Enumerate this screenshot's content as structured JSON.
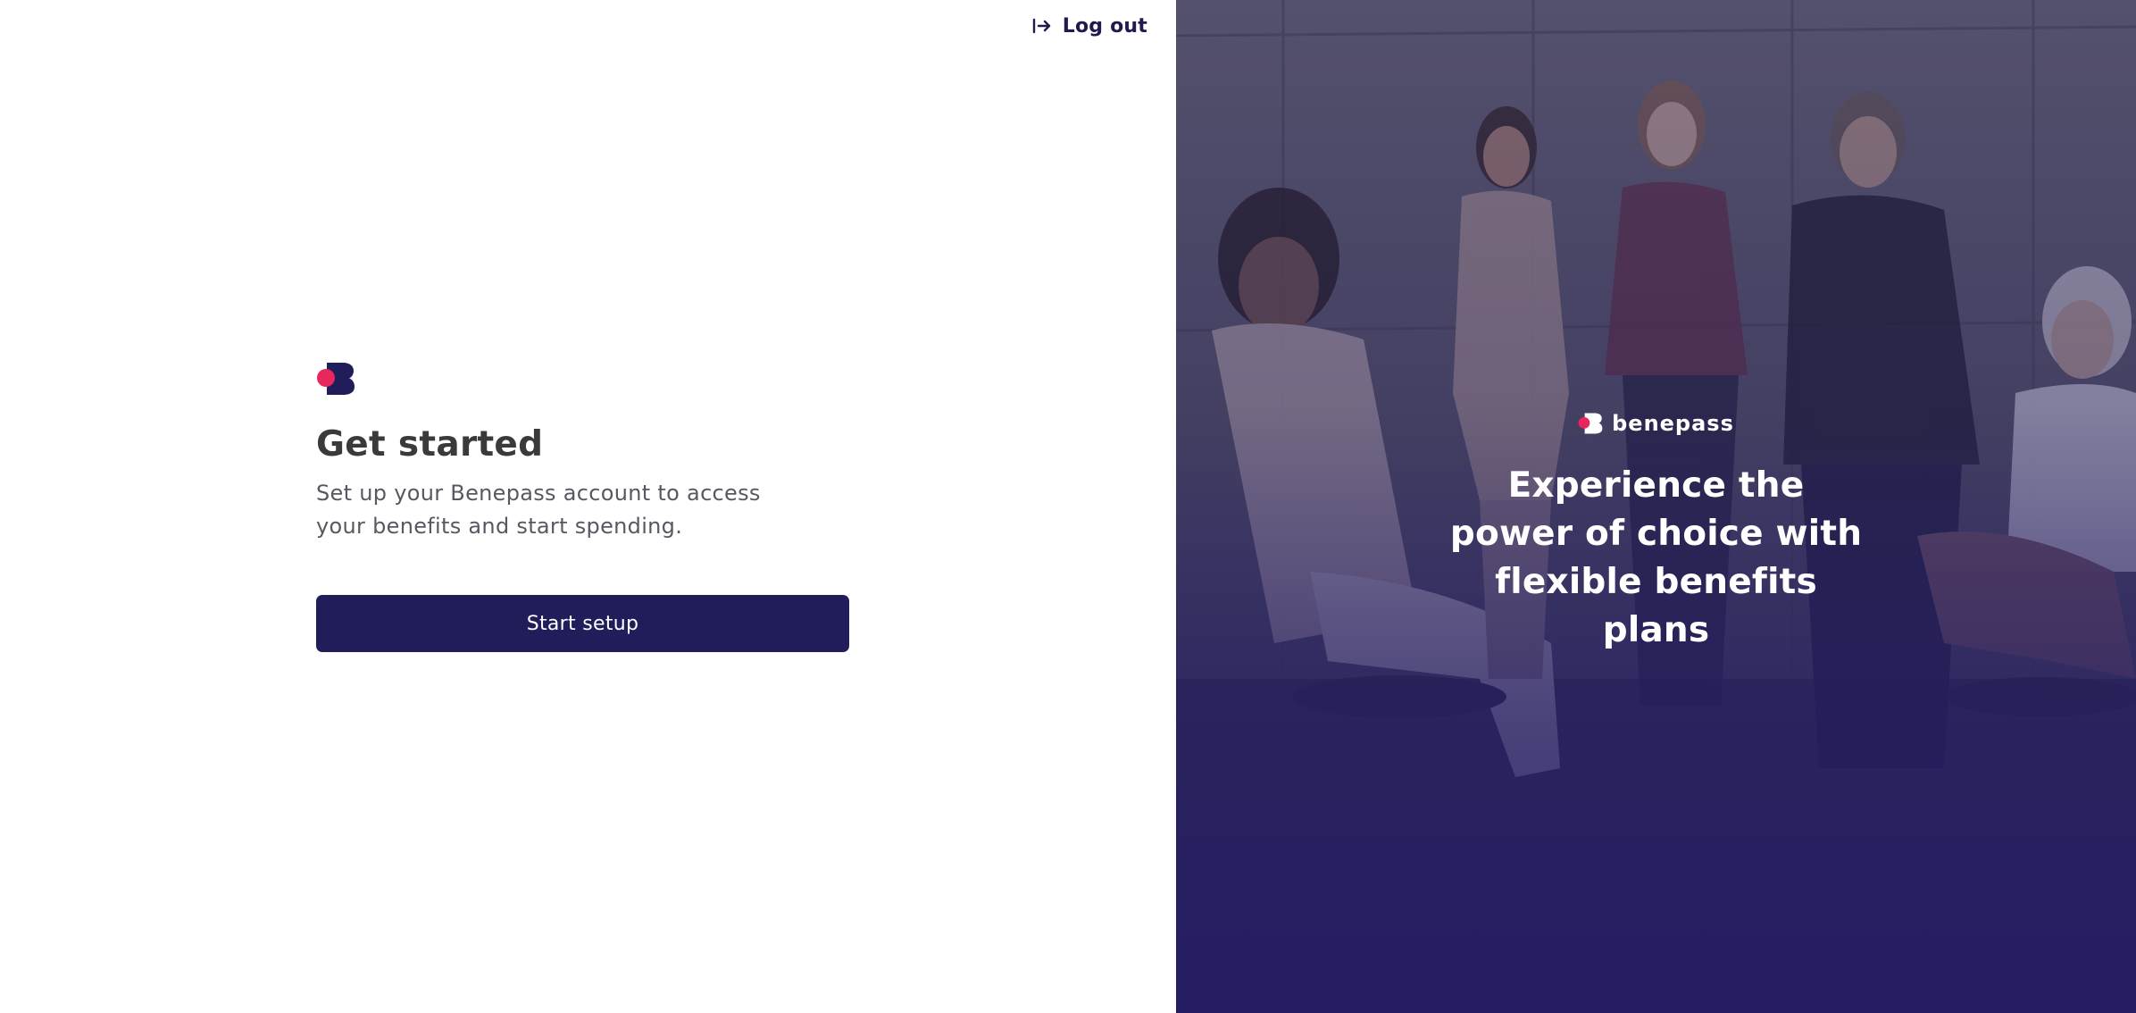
{
  "header": {
    "logout_label": "Log out",
    "logout_icon": "log-out-icon"
  },
  "main": {
    "logo_icon": "benepass-mark-icon",
    "title": "Get started",
    "subtitle": "Set up your Benepass account to access your benefits and start spending.",
    "start_button_label": "Start setup"
  },
  "hero": {
    "brand_name": "benepass",
    "tagline": "Experience the power of choice with flexible benefits plans"
  },
  "colors": {
    "brand_navy": "#211d5a",
    "brand_pink": "#e8285c",
    "title_text": "#3a3a3c",
    "body_text": "#585862"
  }
}
